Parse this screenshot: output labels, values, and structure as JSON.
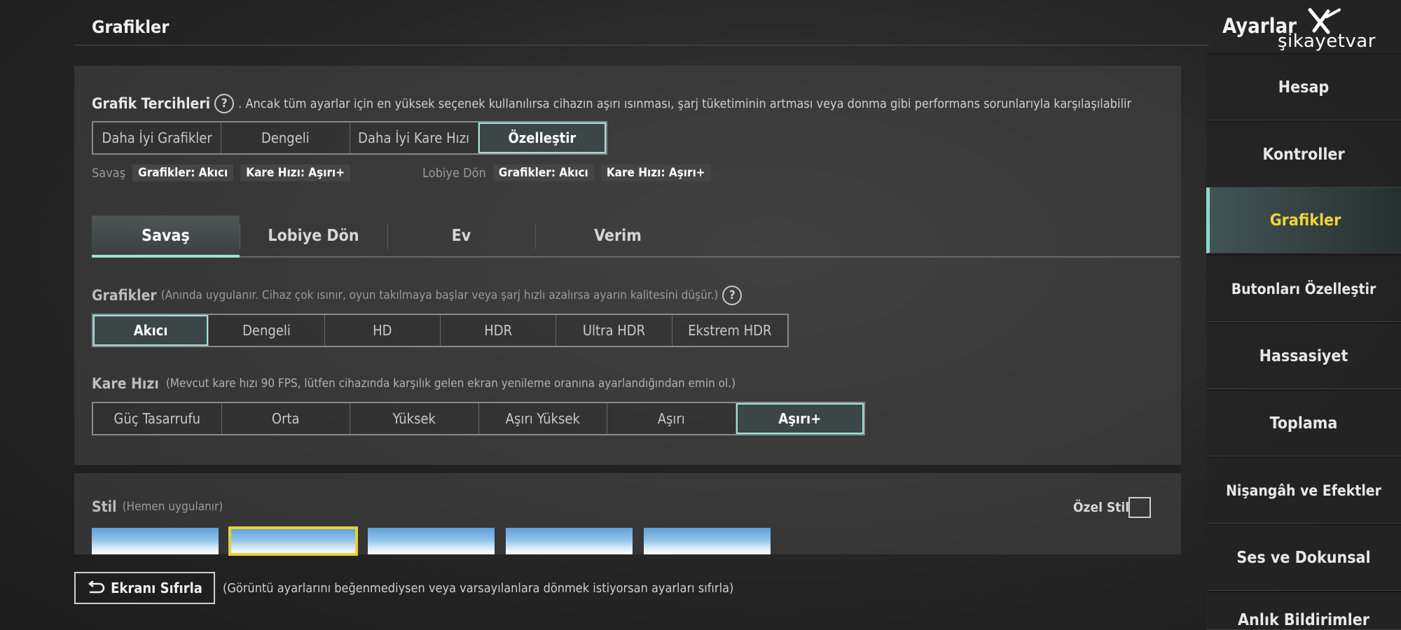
{
  "header": {
    "title": "Grafikler",
    "settings_title": "Ayarlar",
    "watermark": "şikayetvar"
  },
  "prefs": {
    "label": "Grafik Tercihleri",
    "description": ". Ancak tüm ayarlar için en yüksek seçenek kullanılırsa cihazın aşırı ısınması, şarj tüketiminin artması veya donma gibi performans sorunlarıyla karşılaşılabilir",
    "options": [
      "Daha İyi Grafikler",
      "Dengeli",
      "Daha İyi Kare Hızı",
      "Özelleştir"
    ],
    "selected": "Özelleştir"
  },
  "summary": {
    "savas_label": "Savaş",
    "savas_graphics": "Grafikler: Akıcı",
    "savas_fps": "Kare Hızı: Aşırı+",
    "lobby_label": "Lobiye Dön",
    "lobby_graphics": "Grafikler: Akıcı",
    "lobby_fps": "Kare Hızı: Aşırı+"
  },
  "tabs": [
    "Savaş",
    "Lobiye Dön",
    "Ev",
    "Verim"
  ],
  "active_tab": "Savaş",
  "graphics": {
    "label": "Grafikler",
    "hint": "(Anında uygulanır. Cihaz çok ısınır, oyun takılmaya başlar veya şarj hızlı azalırsa ayarın kalitesini düşür.)",
    "options": [
      "Akıcı",
      "Dengeli",
      "HD",
      "HDR",
      "Ultra HDR",
      "Ekstrem HDR"
    ],
    "selected": "Akıcı"
  },
  "framerate": {
    "label": "Kare Hızı",
    "hint": "(Mevcut kare hızı 90 FPS, lütfen cihazında karşılık gelen ekran yenileme oranına ayarlandığından emin ol.)",
    "options": [
      "Güç Tasarrufu",
      "Orta",
      "Yüksek",
      "Aşırı Yüksek",
      "Aşırı",
      "Aşırı+"
    ],
    "selected": "Aşırı+"
  },
  "style": {
    "label": "Stil",
    "hint": "(Hemen uygulanır)",
    "custom_label": "Özel Stil",
    "custom_checked": false,
    "selected_index": 1
  },
  "reset": {
    "label": "Ekranı Sıfırla",
    "hint": "(Görüntü ayarlarını beğenmediysen veya varsayılanlara dönmek istiyorsan ayarları sıfırla)"
  },
  "sidebar": [
    {
      "label": "Hesap"
    },
    {
      "label": "Kontroller"
    },
    {
      "label": "Grafikler",
      "active": true
    },
    {
      "label": "Butonları Özelleştir"
    },
    {
      "label": "Hassasiyet"
    },
    {
      "label": "Toplama"
    },
    {
      "label": "Nişangâh ve Efektler"
    },
    {
      "label": "Ses ve Dokunsal"
    },
    {
      "label": "Anlık Bildirimler"
    }
  ],
  "colors": {
    "accent": "#9fe0d8",
    "active_sidebar_text": "#f2d43a",
    "selected_style_border": "#e6d23a"
  }
}
